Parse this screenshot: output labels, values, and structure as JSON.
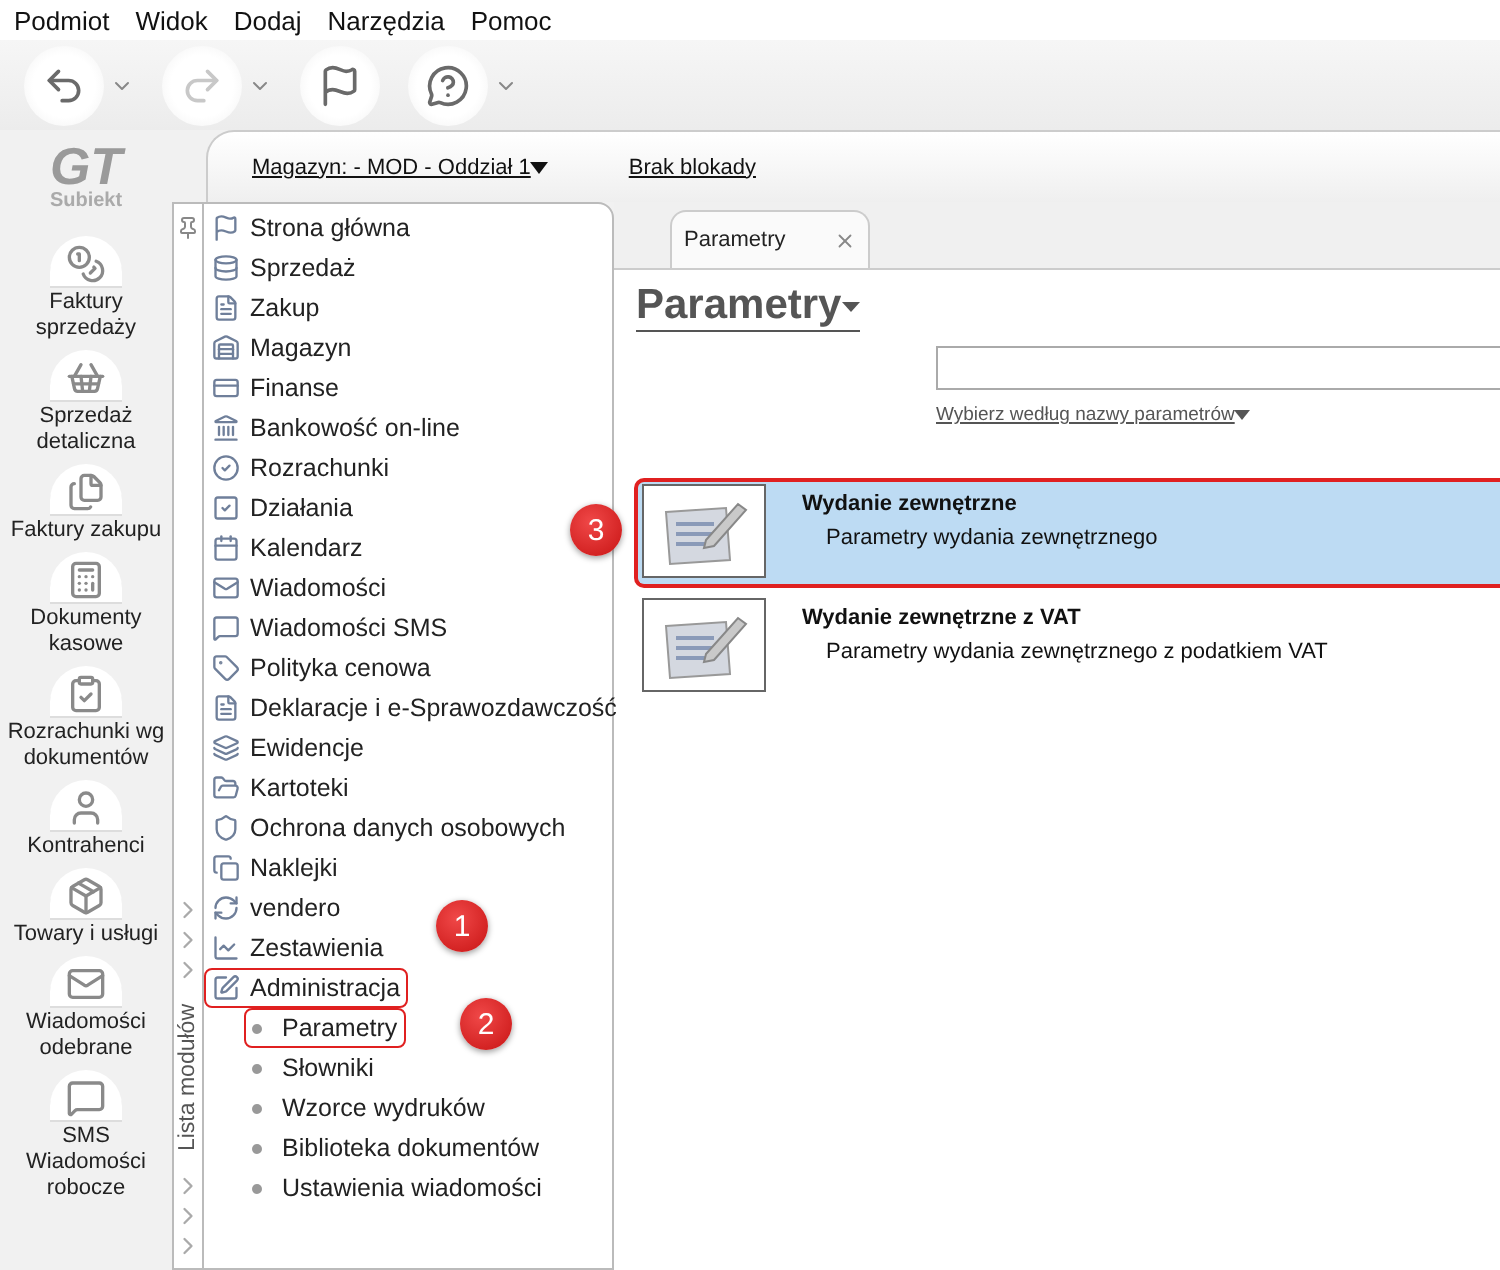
{
  "menu": [
    "Podmiot",
    "Widok",
    "Dodaj",
    "Narzędzia",
    "Pomoc"
  ],
  "toolbar": [
    {
      "kind": "back",
      "disabled": false,
      "dropdown": true
    },
    {
      "kind": "forward",
      "disabled": true,
      "dropdown": true
    },
    {
      "kind": "flag",
      "disabled": false,
      "dropdown": false
    },
    {
      "kind": "help",
      "disabled": false,
      "dropdown": true
    }
  ],
  "logo": {
    "mark": "GT",
    "brand": "Subiekt"
  },
  "shortcuts": [
    "Faktury sprzedaży",
    "Sprzedaż detaliczna",
    "Faktury zakupu",
    "Dokumenty kasowe",
    "Rozrachunki wg dokumentów",
    "Kontrahenci",
    "Towary i usługi",
    "Wiadomości odebrane",
    "SMS Wiadomości robocze"
  ],
  "header": {
    "warehouse_link": "Magazyn: - MOD - Oddział 1",
    "lock_link": "Brak blokady"
  },
  "module_panel": {
    "title": "Lista modułów",
    "modules": [
      {
        "label": "Strona główna"
      },
      {
        "label": "Sprzedaż"
      },
      {
        "label": "Zakup"
      },
      {
        "label": "Magazyn"
      },
      {
        "label": "Finanse"
      },
      {
        "label": "Bankowość on-line"
      },
      {
        "label": "Rozrachunki"
      },
      {
        "label": "Działania"
      },
      {
        "label": "Kalendarz"
      },
      {
        "label": "Wiadomości"
      },
      {
        "label": "Wiadomości SMS"
      },
      {
        "label": "Polityka cenowa"
      },
      {
        "label": "Deklaracje i e-Sprawozdawczość"
      },
      {
        "label": "Ewidencje"
      },
      {
        "label": "Kartoteki"
      },
      {
        "label": "Ochrona danych osobowych"
      },
      {
        "label": "Naklejki"
      },
      {
        "label": "vendero"
      },
      {
        "label": "Zestawienia"
      },
      {
        "label": "Administracja",
        "marker": "1",
        "children": [
          {
            "label": "Parametry",
            "marker": "2"
          },
          {
            "label": "Słowniki"
          },
          {
            "label": "Wzorce wydruków"
          },
          {
            "label": "Biblioteka dokumentów"
          },
          {
            "label": "Ustawienia wiadomości"
          }
        ]
      }
    ]
  },
  "tabs": [
    {
      "label": "Parametry",
      "selected": true
    }
  ],
  "page": {
    "title": "Parametry",
    "filter_link": "Wybierz według nazwy parametrów"
  },
  "results": [
    {
      "title": "Wydanie zewnętrzne",
      "description": "Parametry wydania zewnętrznego",
      "selected": true,
      "marker": "3"
    },
    {
      "title": "Wydanie zewnętrzne z VAT",
      "description": "Parametry wydania zewnętrznego z podatkiem VAT",
      "selected": false
    }
  ]
}
